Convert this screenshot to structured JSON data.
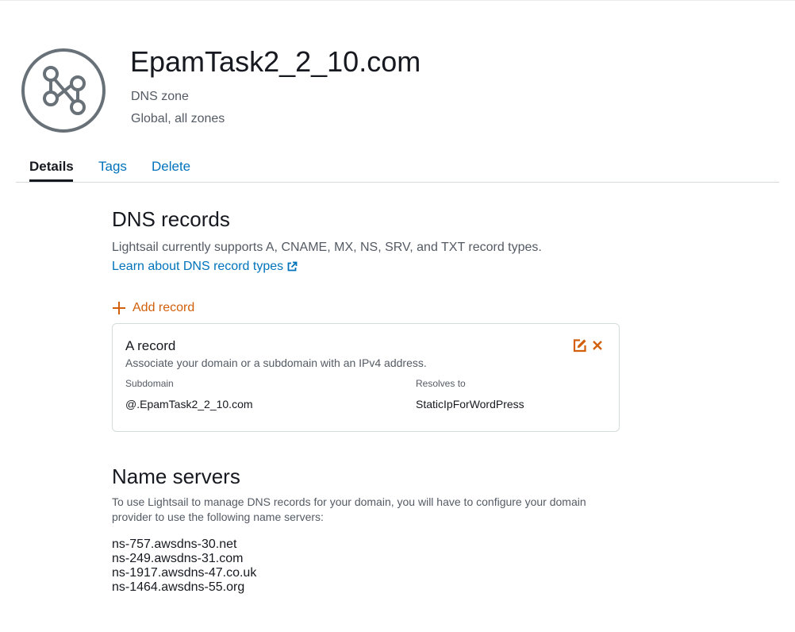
{
  "header": {
    "icon": "dns-zone-icon",
    "title": "EpamTask2_2_10.com",
    "type": "DNS zone",
    "scope": "Global, all zones"
  },
  "tabs": [
    {
      "label": "Details",
      "active": true
    },
    {
      "label": "Tags",
      "active": false
    },
    {
      "label": "Delete",
      "active": false
    }
  ],
  "dns_records": {
    "title": "DNS records",
    "description": "Lightsail currently supports A, CNAME, MX, NS, SRV, and TXT record types.",
    "learn_link": "Learn about DNS record types",
    "add_label": "Add record",
    "records": [
      {
        "title": "A record",
        "description": "Associate your domain or a subdomain with an IPv4 address.",
        "subdomain_label": "Subdomain",
        "subdomain_value": "@.EpamTask2_2_10.com",
        "resolves_label": "Resolves to",
        "resolves_value": "StaticIpForWordPress"
      }
    ]
  },
  "name_servers": {
    "title": "Name servers",
    "description": "To use Lightsail to manage DNS records for your domain, you will have to configure your domain provider to use the following name servers:",
    "servers": [
      "ns-757.awsdns-30.net",
      "ns-249.awsdns-31.com",
      "ns-1917.awsdns-47.co.uk",
      "ns-1464.awsdns-55.org"
    ]
  },
  "colors": {
    "accent_orange": "#d15f0b",
    "link_blue": "#0073bb",
    "icon_gray": "#687078"
  }
}
